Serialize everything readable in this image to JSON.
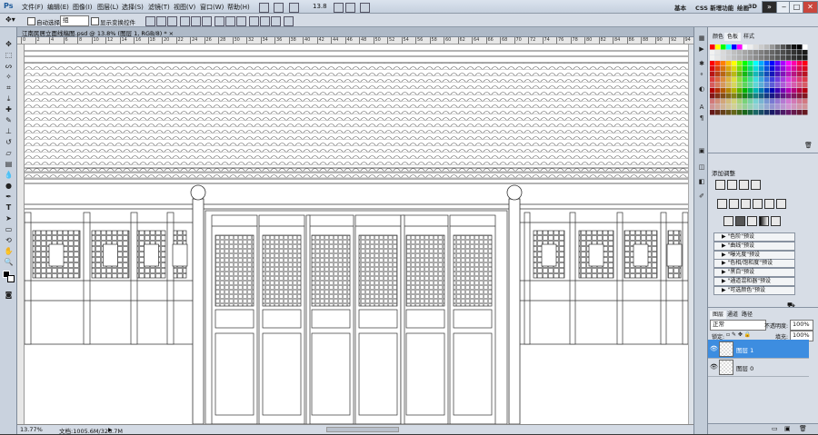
{
  "app": {
    "logo": "Ps"
  },
  "menu": [
    "文件(F)",
    "编辑(E)",
    "图像(I)",
    "图层(L)",
    "选择(S)",
    "滤镜(T)",
    "视图(V)",
    "窗口(W)",
    "帮助(H)"
  ],
  "menu_zoom": "13.8",
  "workspaces": [
    "基本",
    "CSS 新增功能",
    "绘画",
    "3D"
  ],
  "window_buttons": [
    "»",
    "‒",
    "□",
    "✕"
  ],
  "options": {
    "auto_select_label": "自动选择:",
    "auto_select_value": "组",
    "show_transform_label": "显示变换控件"
  },
  "document": {
    "tab_title": "江南民居立面线稿图.psd @ 13.8% (图层 1, RGB/8) * ×",
    "zoom": "13.77%",
    "doc_info": "文档:1005.6M/326.7M",
    "ruler_ticks": [
      "0",
      "2",
      "4",
      "6",
      "8",
      "10",
      "12",
      "14",
      "16",
      "18",
      "20",
      "22",
      "24",
      "26",
      "28",
      "30",
      "32",
      "34",
      "36",
      "38",
      "40",
      "42",
      "44",
      "46",
      "48",
      "50",
      "52",
      "54",
      "56",
      "58",
      "60",
      "62",
      "64",
      "66",
      "68",
      "70",
      "72",
      "74",
      "76",
      "78",
      "80",
      "82",
      "84",
      "86",
      "88",
      "90",
      "92",
      "94"
    ]
  },
  "swatch_panel": {
    "tabs": [
      "颜色",
      "色板",
      "样式"
    ],
    "active": "色板"
  },
  "adjustments": {
    "title": "添加调整",
    "presets": [
      "\"色阶\"预设",
      "\"曲线\"预设",
      "\"曝光度\"预设",
      "\"色相/饱和度\"预设",
      "\"黑白\"预设",
      "\"通道混和器\"预设",
      "\"可选颜色\"预设"
    ]
  },
  "layers": {
    "tabs": [
      "图层",
      "通道",
      "路径"
    ],
    "blend_mode": "正常",
    "opacity_label": "不透明度:",
    "opacity": "100%",
    "lock_label": "锁定:",
    "fill_label": "填充:",
    "fill": "100%",
    "items": [
      {
        "name": "图层 1",
        "selected": true
      },
      {
        "name": "图层 0",
        "selected": false
      }
    ]
  },
  "colors": {
    "accent": "#3a8ee6",
    "selected_layer": "#3d8de0",
    "ui_bg": "#d7dde6"
  },
  "icons": [
    "move-tool-icon",
    "marquee-icon",
    "lasso-icon",
    "magic-wand-icon",
    "crop-icon",
    "eyedropper-icon",
    "heal-icon",
    "brush-icon",
    "stamp-icon",
    "history-brush-icon",
    "eraser-icon",
    "gradient-icon",
    "blur-icon",
    "dodge-icon",
    "pen-icon",
    "type-icon",
    "path-select-icon",
    "shape-icon",
    "3d-rotate-icon",
    "hand-icon",
    "zoom-icon"
  ]
}
